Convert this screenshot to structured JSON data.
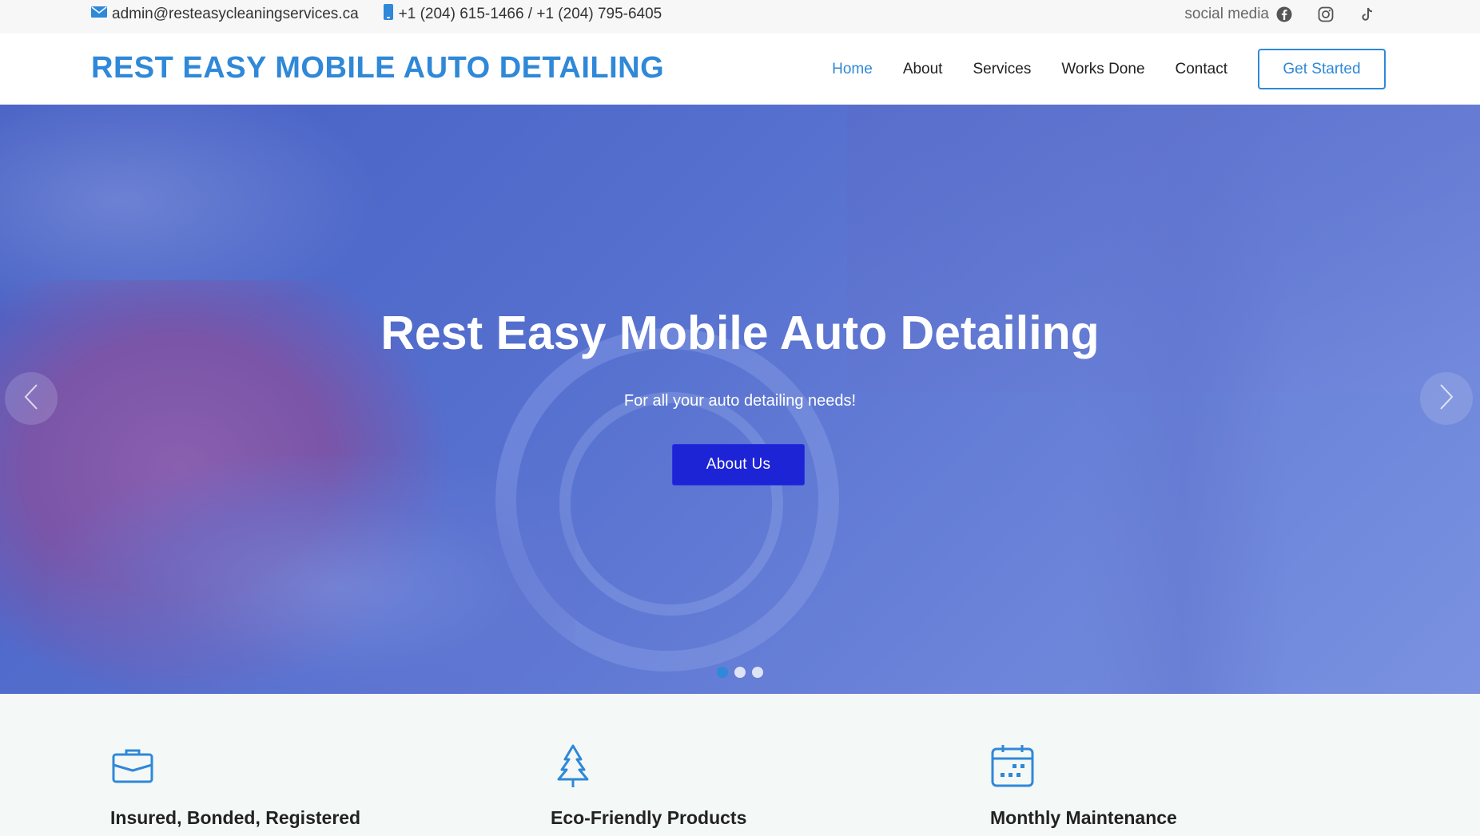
{
  "topbar": {
    "email": "admin@resteasycleaningservices.ca",
    "phone": "+1 (204) 615-1466 / +1 (204) 795-6405",
    "social_label": "social media",
    "social_icons": [
      "facebook-icon",
      "instagram-icon",
      "tiktok-icon"
    ]
  },
  "header": {
    "logo": "REST EASY MOBILE AUTO DETAILING",
    "nav": [
      "Home",
      "About",
      "Services",
      "Works Done",
      "Contact"
    ],
    "active_nav": "Home",
    "cta": "Get Started"
  },
  "hero": {
    "title": "Rest Easy Mobile Auto Detailing",
    "subtitle": "For all your auto detailing needs!",
    "button": "About Us",
    "slide_count": 3,
    "active_slide": 1
  },
  "features": [
    {
      "icon": "briefcase-icon",
      "title": "Insured, Bonded, Registered"
    },
    {
      "icon": "tree-icon",
      "title": "Eco-Friendly Products"
    },
    {
      "icon": "calendar-icon",
      "title": "Monthly Maintenance"
    }
  ],
  "colors": {
    "accent": "#2f88d8",
    "hero_button": "#1c24d6",
    "topbar_bg": "#f7f7f7",
    "features_bg": "#f4f9f7"
  }
}
